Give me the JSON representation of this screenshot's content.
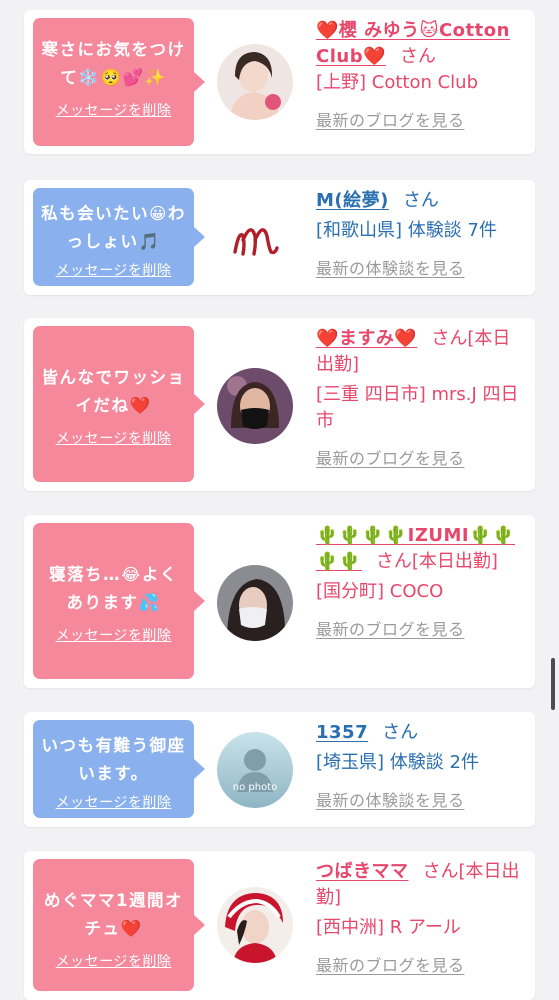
{
  "cards": [
    {
      "message": "寒さにお気をつけて❄️🥺💕✨",
      "delete_label": "メッセージを削除",
      "name": "❤️櫻 みゆう🐱Cotton Club❤️",
      "suffix": "さん",
      "location": "[上野] Cotton Club",
      "link": "最新のブログを見る",
      "avatar": "photo-avatar"
    },
    {
      "message": "私も会いたい😀わっしょい🎵",
      "delete_label": "メッセージを削除",
      "name": "M(絵夢)",
      "suffix": "さん",
      "location": "[和歌山県] 体験談 7件",
      "link": "最新の体験談を見る",
      "avatar": "signature-m-avatar"
    },
    {
      "message": "皆んなでワッショイだね❤️",
      "delete_label": "メッセージを削除",
      "name": "❤️ますみ❤️",
      "suffix": "さん[本日出勤]",
      "location": "[三重 四日市] mrs.J 四日市",
      "link": "最新のブログを見る",
      "avatar": "photo-avatar"
    },
    {
      "message": "寝落ち…😂よくあります💦",
      "delete_label": "メッセージを削除",
      "name": "🌵🌵🌵🌵IZUMI🌵🌵🌵🌵",
      "suffix": "さん[本日出勤]",
      "location": "[国分町] COCO",
      "link": "最新のブログを見る",
      "avatar": "photo-avatar"
    },
    {
      "message": "いつも有難う御座います。",
      "delete_label": "メッセージを削除",
      "name": "1357",
      "suffix": "さん",
      "location": "[埼玉県] 体験談 2件",
      "link": "最新の体験談を見る",
      "avatar": "no-photo-avatar",
      "avatar_text": "no photo"
    },
    {
      "message": "めぐママ1週間オチュ❤️",
      "delete_label": "メッセージを削除",
      "name": "つばきママ",
      "suffix": "さん[本日出勤]",
      "location": "[西中洲] R アール",
      "link": "最新のブログを見る",
      "avatar": "photo-avatar"
    }
  ],
  "colors": {
    "pink_bubble": "#f6889c",
    "blue_bubble": "#8ab0ee",
    "pink_text": "#e8476c",
    "blue_text": "#2a6fb0",
    "muted_link": "#9a9a9a"
  }
}
